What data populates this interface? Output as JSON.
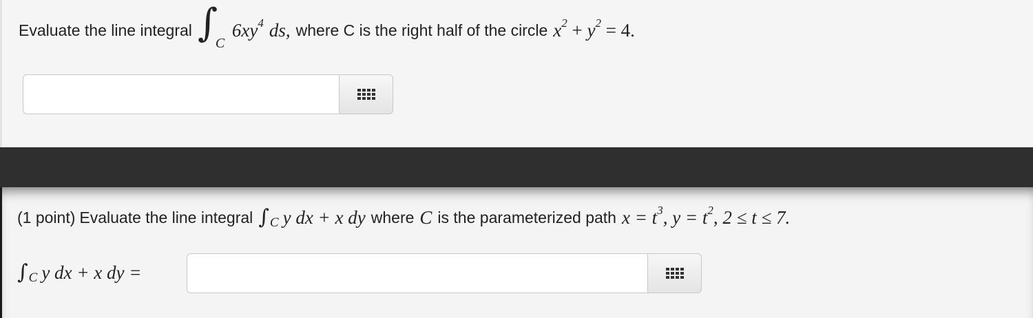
{
  "question1": {
    "prompt_prefix": "Evaluate the line integral",
    "integral_subscript": "C",
    "integrand": "6xy",
    "integrand_exponent": "4",
    "differential": "ds,",
    "middle_text": "where C is the right half of the circle",
    "eq_x": "x",
    "eq_x_exp": "2",
    "eq_plus": "+",
    "eq_y": "y",
    "eq_y_exp": "2",
    "eq_rhs": "= 4.",
    "answer_value": ""
  },
  "question2": {
    "points": "(1 point)",
    "prompt_prefix": "Evaluate the line integral",
    "integral_subscript": "C",
    "integrand": "y dx + x dy",
    "where_text": "where",
    "curve_name": "C",
    "is_text": "is the parameterized path",
    "x_eq": "x = t",
    "x_exp": "3",
    "y_eq": ", y = t",
    "y_exp": "2",
    "range": ", 2 ≤ t ≤ 7.",
    "answer_label": "y dx + x dy =",
    "answer_value": ""
  },
  "icons": {
    "palette": "grid-icon"
  }
}
